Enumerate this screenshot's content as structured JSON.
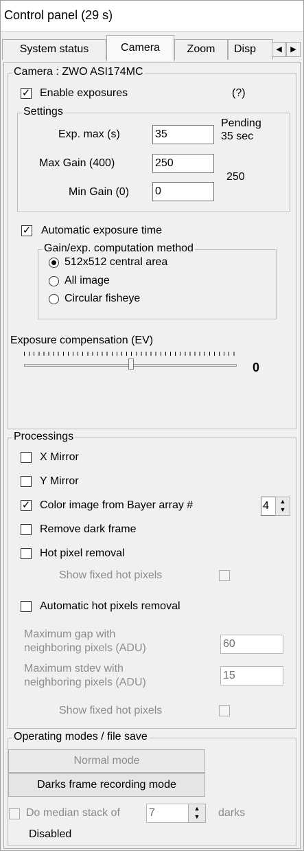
{
  "window": {
    "title": "Control panel (29 s)"
  },
  "tabs": [
    "System status",
    "Camera",
    "Zoom",
    "Disp"
  ],
  "camera": {
    "group_label": "Camera : ZWO ASI174MC",
    "enable_exposures": "Enable exposures",
    "help": "(?)",
    "settings": {
      "label": "Settings",
      "exp_max_label": "Exp. max (s)",
      "exp_max_value": "35",
      "pending_label": "Pending",
      "pending_value": "35 sec",
      "max_gain_label": "Max Gain (400)",
      "max_gain_value": "250",
      "min_gain_label": "Min Gain (0)",
      "min_gain_value": "0",
      "current_gain": "250"
    },
    "auto_exposure": "Automatic exposure time",
    "method": {
      "label": "Gain/exp. computation method",
      "options": [
        "512x512 central area",
        "All image",
        "Circular fisheye"
      ],
      "selected": "512x512 central area"
    },
    "ev_label": "Exposure compensation (EV)",
    "ev_value": "0",
    "ev_position": 0.5
  },
  "processings": {
    "label": "Processings",
    "x_mirror": "X Mirror",
    "y_mirror": "Y Mirror",
    "color_bayer": "Color image from Bayer array #",
    "bayer_value": "4",
    "remove_dark": "Remove dark frame",
    "hot_pixel": "Hot pixel removal",
    "show_fixed_1": "Show fixed hot pixels",
    "auto_hot": "Automatic hot pixels removal",
    "max_gap_line1": "Maximum gap with",
    "max_gap_line2": "neighboring pixels (ADU)",
    "max_gap_value": "60",
    "max_stdev_line1": "Maximum stdev with",
    "max_stdev_line2": "neighboring pixels (ADU)",
    "max_stdev_value": "15",
    "show_fixed_2": "Show fixed hot pixels"
  },
  "operating": {
    "label": "Operating modes / file save",
    "normal_mode": "Normal mode",
    "darks_mode": "Darks frame recording mode",
    "median_label": "Do median stack of",
    "median_value": "7",
    "darks_label": "darks",
    "status": "Disabled"
  }
}
